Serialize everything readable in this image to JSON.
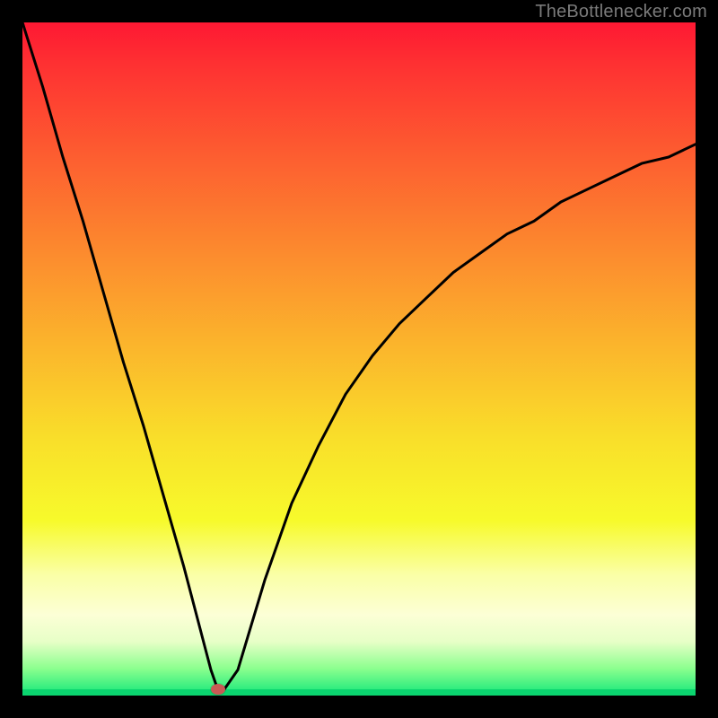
{
  "watermark": "TheBottlenecker.com",
  "colors": {
    "background": "#000000",
    "curve": "#000000",
    "marker": "#c85a55",
    "gradient_top": "#fe1833",
    "gradient_bottom": "#13e77a"
  },
  "chart_data": {
    "type": "line",
    "title": "",
    "xlabel": "",
    "ylabel": "",
    "xlim": [
      0,
      100
    ],
    "ylim": [
      0,
      105
    ],
    "grid": false,
    "legend": false,
    "background": "rainbow-vertical-gradient",
    "series": [
      {
        "name": "bottleneck-curve",
        "x": [
          0,
          3,
          6,
          9,
          12,
          15,
          18,
          21,
          24,
          26,
          27,
          28,
          29,
          30,
          32,
          34,
          36,
          38,
          40,
          44,
          48,
          52,
          56,
          60,
          64,
          68,
          72,
          76,
          80,
          84,
          88,
          92,
          96,
          100
        ],
        "y": [
          105,
          95,
          84,
          74,
          63,
          52,
          42,
          31,
          20,
          12,
          8,
          4,
          1,
          1,
          4,
          11,
          18,
          24,
          30,
          39,
          47,
          53,
          58,
          62,
          66,
          69,
          72,
          74,
          77,
          79,
          81,
          83,
          84,
          86
        ]
      }
    ],
    "annotations": [
      {
        "name": "optimal-marker",
        "x": 29,
        "y": 1,
        "shape": "ellipse",
        "color": "#c85a55"
      }
    ]
  }
}
